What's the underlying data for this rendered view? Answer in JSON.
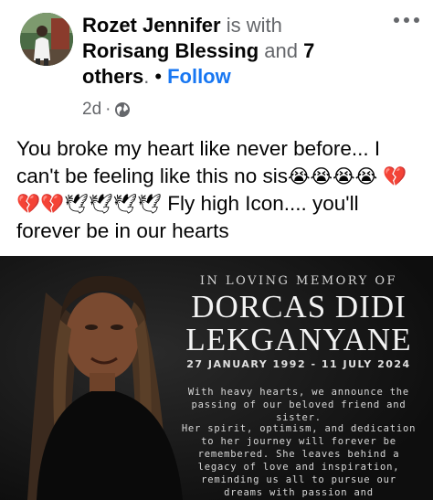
{
  "post": {
    "author": "Rozet Jennifer",
    "is_with": "is with",
    "tagged": "Rorisang Blessing",
    "and": "and",
    "others": "7 others",
    "period": ".",
    "bullet": "•",
    "follow_label": "Follow",
    "time": "2d",
    "time_sep": "·",
    "more_label": "•••",
    "privacy_icon": "globe-icon",
    "text_line": "You broke my heart like never before... I can't be feeling like this no sis",
    "emojis_crying": "😭😭😭😭",
    "emojis_hearts": "💔💔💔",
    "emojis_doves": "🕊🕊🕊🕊",
    "text_tail": "Fly high Icon.... you'll forever be in our hearts"
  },
  "memorial": {
    "kicker": "IN LOVING MEMORY OF",
    "name_line1": "DORCAS DIDI",
    "name_line2": "LEKGANYANE",
    "dates": "27 JANUARY 1992 - 11 JULY 2024",
    "para1": "With heavy hearts, we announce the passing of our beloved friend and sister.",
    "para2": "Her spirit, optimism, and dedication to her journey will forever be remembered. She leaves behind a legacy of love and inspiration, reminding us all to pursue our dreams with passion and determination."
  },
  "colors": {
    "link_blue": "#1877f2",
    "muted": "#65676b",
    "photo_bg": "#141414"
  }
}
